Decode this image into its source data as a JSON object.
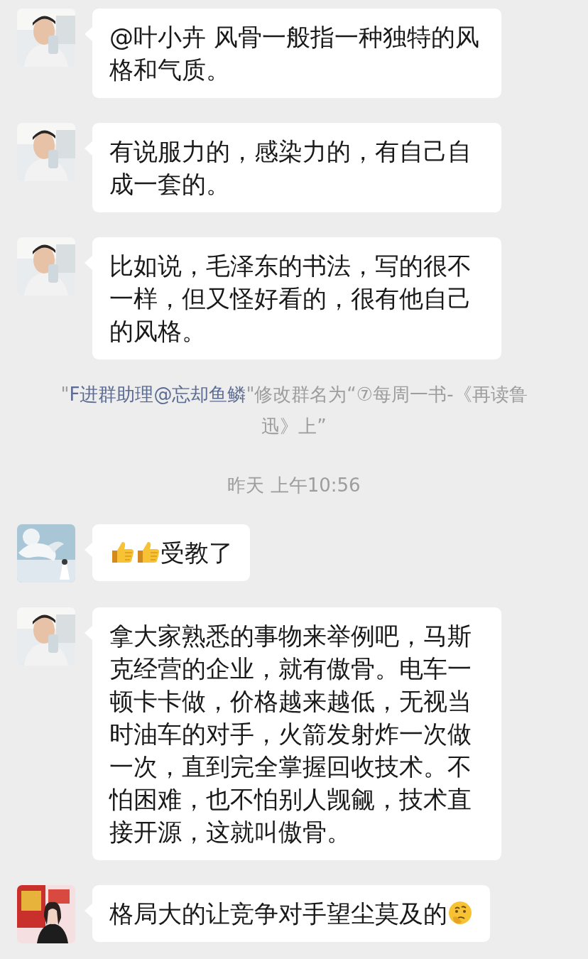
{
  "messages": [
    {
      "kind": "message",
      "avatar": {
        "kind": "picture"
      },
      "parts": [
        {
          "kind": "text",
          "text": "@叶小卉 风骨一般指一种独特的风格和气质。"
        }
      ]
    },
    {
      "kind": "message",
      "avatar": {
        "kind": "picture"
      },
      "parts": [
        {
          "kind": "text",
          "text": "有说服力的，感染力的，有自己自成一套的。"
        }
      ]
    },
    {
      "kind": "message",
      "avatar": {
        "kind": "picture"
      },
      "parts": [
        {
          "kind": "text",
          "text": "比如说，毛泽东的书法，写的很不一样，但又怪好看的，很有他自己的风格。"
        }
      ]
    },
    {
      "kind": "notice",
      "before": "\"",
      "link": "F进群助理@忘却鱼鳞",
      "after": "\"修改群名为“⑦每周一书-《再读鲁迅》上”"
    },
    {
      "kind": "time",
      "text": "昨天 上午10:56"
    },
    {
      "kind": "message",
      "avatar": {
        "kind": "picture"
      },
      "parts": [
        {
          "kind": "thumbs_up"
        },
        {
          "kind": "thumbs_up"
        },
        {
          "kind": "text",
          "text": "受教了"
        }
      ]
    },
    {
      "kind": "message",
      "avatar": {
        "kind": "picture"
      },
      "parts": [
        {
          "kind": "text",
          "text": "拿大家熟悉的事物来举例吧，马斯克经营的企业，就有傲骨。电车一顿卡卡做，价格越来越低，无视当时油车的对手，火箭发射炸一次做一次，直到完全掌握回收技术。不怕困难，也不怕别人觊觎，技术直接开源，这就叫傲骨。"
        }
      ]
    },
    {
      "kind": "message",
      "avatar": {
        "kind": "picture"
      },
      "parts": [
        {
          "kind": "text",
          "text": "格局大的让竞争对手望尘莫及的"
        },
        {
          "kind": "thinking"
        }
      ]
    }
  ]
}
